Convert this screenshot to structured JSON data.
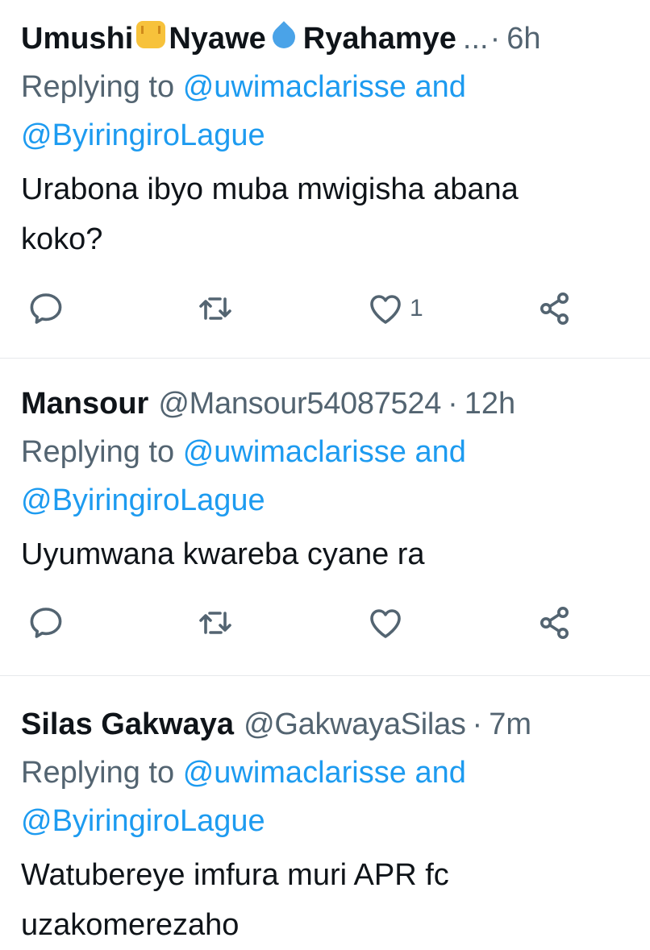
{
  "tweets": [
    {
      "display_name": "Umushi",
      "display_name_part2": "Nyawe",
      "display_name_part3": "Ryahamye",
      "ellipsis": "...",
      "separator": "·",
      "time": "6h",
      "replying_prefix": "Replying to",
      "mention1": "@uwimaclarisse",
      "and_word": "and",
      "mention2": "@ByiringiroLague",
      "text": "Urabona ibyo muba mwigisha abana\nkoko?",
      "like_count": "1"
    },
    {
      "display_name": "Mansour",
      "handle": "@Mansour54087524",
      "separator": "·",
      "time": "12h",
      "replying_prefix": "Replying to",
      "mention1": "@uwimaclarisse",
      "and_word": "and",
      "mention2": "@ByiringiroLague",
      "text": "Uyumwana kwareba cyane ra",
      "like_count": ""
    },
    {
      "display_name": "Silas Gakwaya",
      "handle": "@GakwayaSilas",
      "separator": "·",
      "time": "7m",
      "replying_prefix": "Replying to",
      "mention1": "@uwimaclarisse",
      "and_word": "and",
      "mention2": "@ByiringiroLague",
      "text": "Watubereye imfura muri APR fc\nuzakomerezaho"
    }
  ],
  "icons": {
    "reply": "reply-icon",
    "retweet": "retweet-icon",
    "like": "heart-icon",
    "share": "share-icon",
    "fist_emoji": "raised-fist-emoji-icon",
    "drop_emoji": "droplet-emoji-icon"
  },
  "colors": {
    "text": "#0f1419",
    "secondary": "#536471",
    "link": "#1d9bf0",
    "divider": "#e6e9ec"
  }
}
